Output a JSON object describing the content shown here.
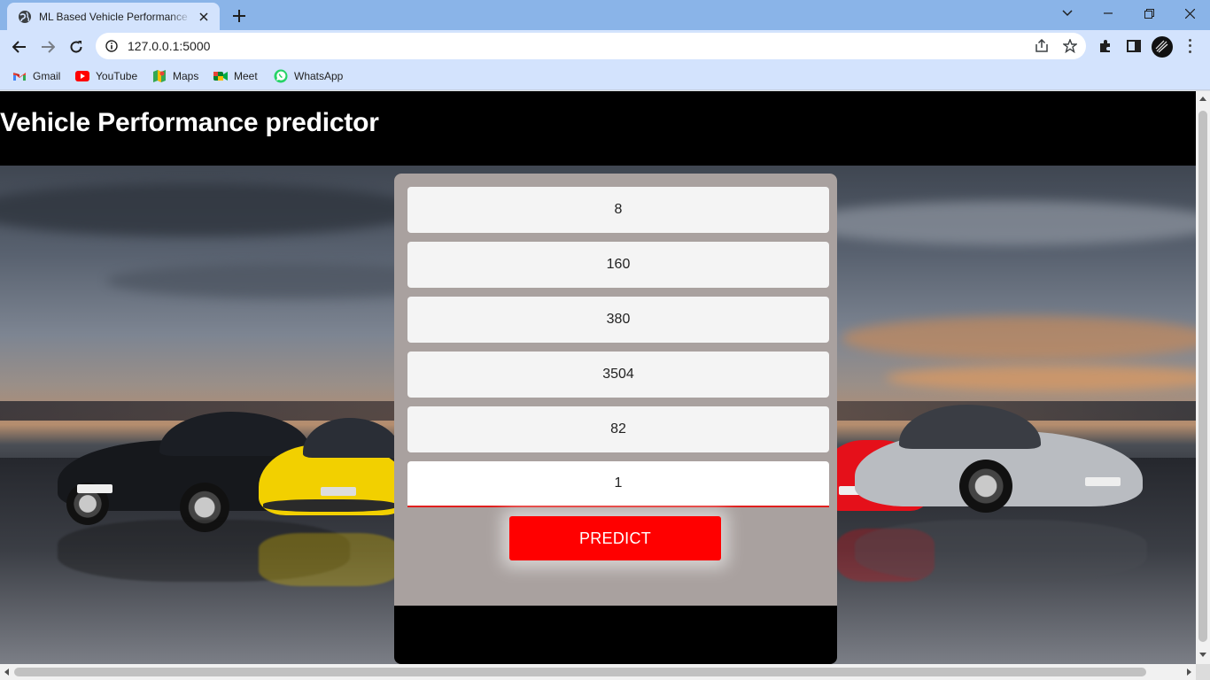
{
  "browser": {
    "tab_title": "ML Based Vehicle Performance Predictor",
    "url": "127.0.0.1:5000",
    "bookmarks": [
      {
        "label": "Gmail",
        "icon": "gmail-icon"
      },
      {
        "label": "YouTube",
        "icon": "youtube-icon"
      },
      {
        "label": "Maps",
        "icon": "maps-icon"
      },
      {
        "label": "Meet",
        "icon": "meet-icon"
      },
      {
        "label": "WhatsApp",
        "icon": "whatsapp-icon"
      }
    ]
  },
  "page": {
    "title": "Vehicle Performance predictor"
  },
  "form": {
    "fields": [
      "8",
      "160",
      "380",
      "3504",
      "82",
      "1"
    ],
    "predict_label": "PREDICT"
  },
  "colors": {
    "tabstrip": "#8ab4e8",
    "toolbar": "#d3e3fd",
    "predict_button": "#ff0000",
    "form_background": "#a9a19f",
    "header_background": "#000000"
  }
}
